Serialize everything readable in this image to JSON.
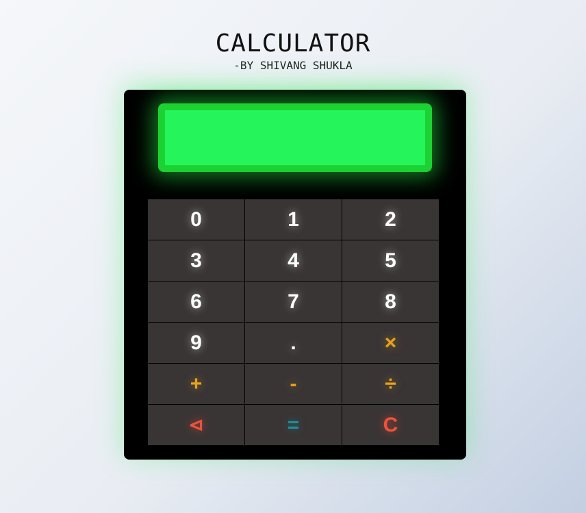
{
  "header": {
    "title": "CALCULATOR",
    "subtitle": "-BY SHIVANG SHUKLA"
  },
  "display": {
    "value": ""
  },
  "keypad": {
    "k0": "0",
    "k1": "1",
    "k2": "2",
    "k3": "3",
    "k4": "4",
    "k5": "5",
    "k6": "6",
    "k7": "7",
    "k8": "8",
    "k9": "9",
    "dot": ".",
    "multiply": "×",
    "add": "+",
    "subtract": "-",
    "divide": "÷",
    "backspace": "⊲",
    "equals": "=",
    "clear": "C"
  },
  "colors": {
    "screen": "#25f55a",
    "operator": "#e8a21b",
    "equals": "#1a8e9a",
    "danger": "#f0513a"
  }
}
